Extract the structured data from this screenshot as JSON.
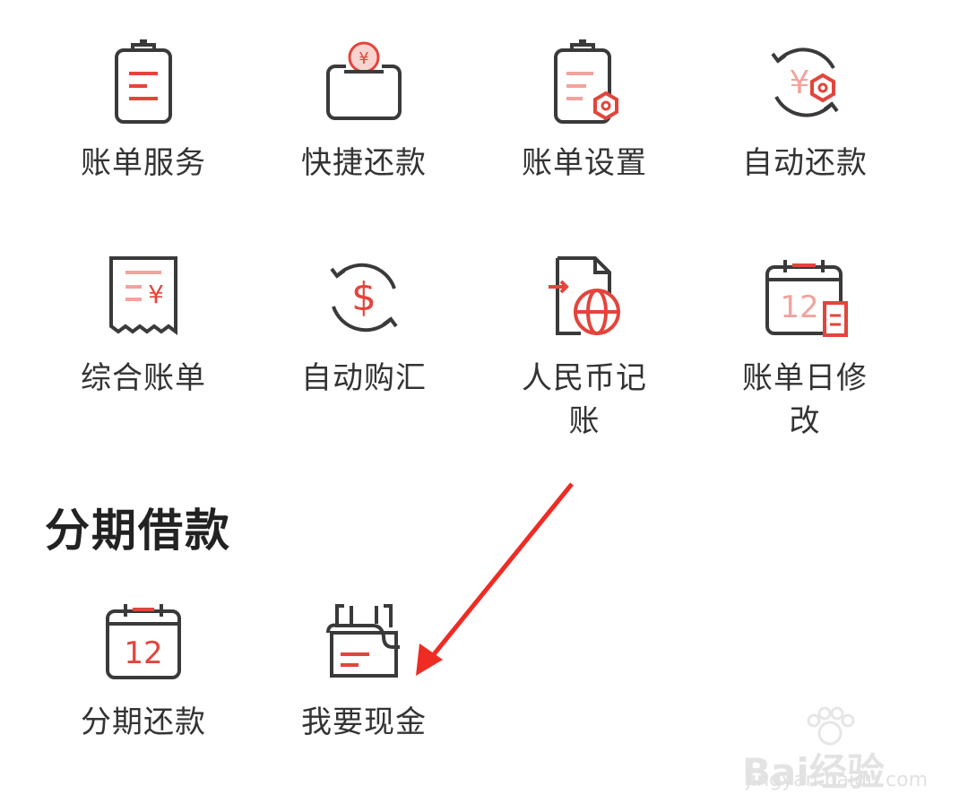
{
  "services": [
    {
      "label": "账单服务",
      "icon": "bill-clipboard-icon"
    },
    {
      "label": "快捷还款",
      "icon": "yuan-coin-wallet-icon"
    },
    {
      "label": "账单设置",
      "icon": "clipboard-settings-icon"
    },
    {
      "label": "自动还款",
      "icon": "auto-refresh-yuan-icon"
    },
    {
      "label": "综合账单",
      "icon": "receipt-yuan-icon"
    },
    {
      "label": "自动购汇",
      "icon": "auto-exchange-dollar-icon"
    },
    {
      "label": "人民币记\n账",
      "icon": "document-globe-icon"
    },
    {
      "label": "账单日修\n改",
      "icon": "calendar-edit-icon"
    }
  ],
  "installment_section": {
    "title": "分期借款",
    "items": [
      {
        "label": "分期还款",
        "icon": "calendar-12-icon",
        "calendar_day": "12"
      },
      {
        "label": "我要现金",
        "icon": "cash-withdraw-icon"
      }
    ]
  },
  "annotation": {
    "type": "red-arrow",
    "target": "我要现金"
  },
  "watermark": {
    "text": "Bai经验",
    "url": "jingyan.baidu.com"
  },
  "colors": {
    "accent": "#e2453c",
    "icon_stroke": "#3a3a3a",
    "text": "#333333"
  }
}
